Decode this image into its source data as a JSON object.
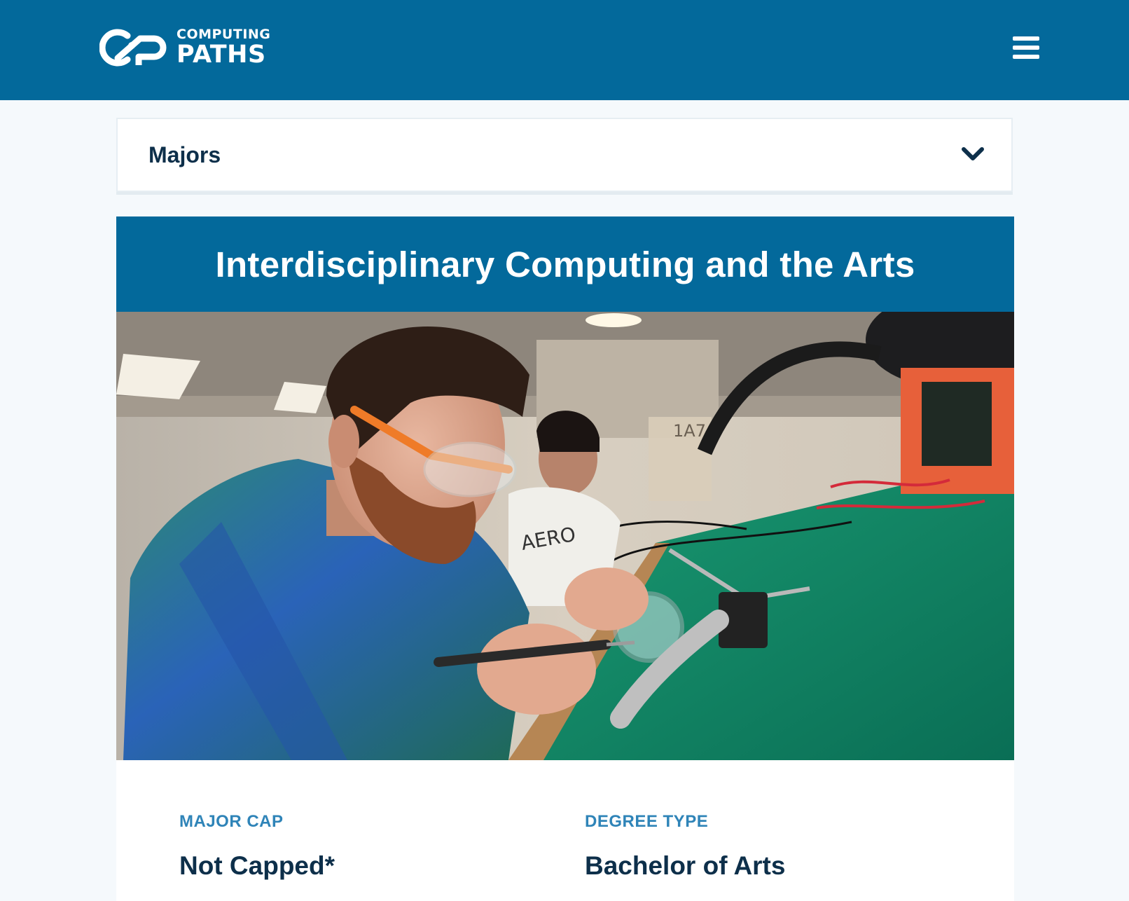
{
  "header": {
    "logo_top": "COMPUTING",
    "logo_bottom": "PATHS",
    "menu_icon": "hamburger-icon",
    "background_color": "#03699b"
  },
  "dropdown": {
    "label": "Majors",
    "icon": "chevron-down-icon"
  },
  "major": {
    "title": "Interdisciplinary Computing and the Arts",
    "hero_image": "students-soldering-electronics-photo",
    "info": [
      {
        "label": "MAJOR CAP",
        "value": "Not Capped*"
      },
      {
        "label": "DEGREE TYPE",
        "value": "Bachelor of Arts"
      }
    ]
  },
  "colors": {
    "primary": "#03699b",
    "heading_text": "#0d2f4a",
    "label_text": "#2f84b8",
    "page_bg": "#f5f9fc"
  }
}
